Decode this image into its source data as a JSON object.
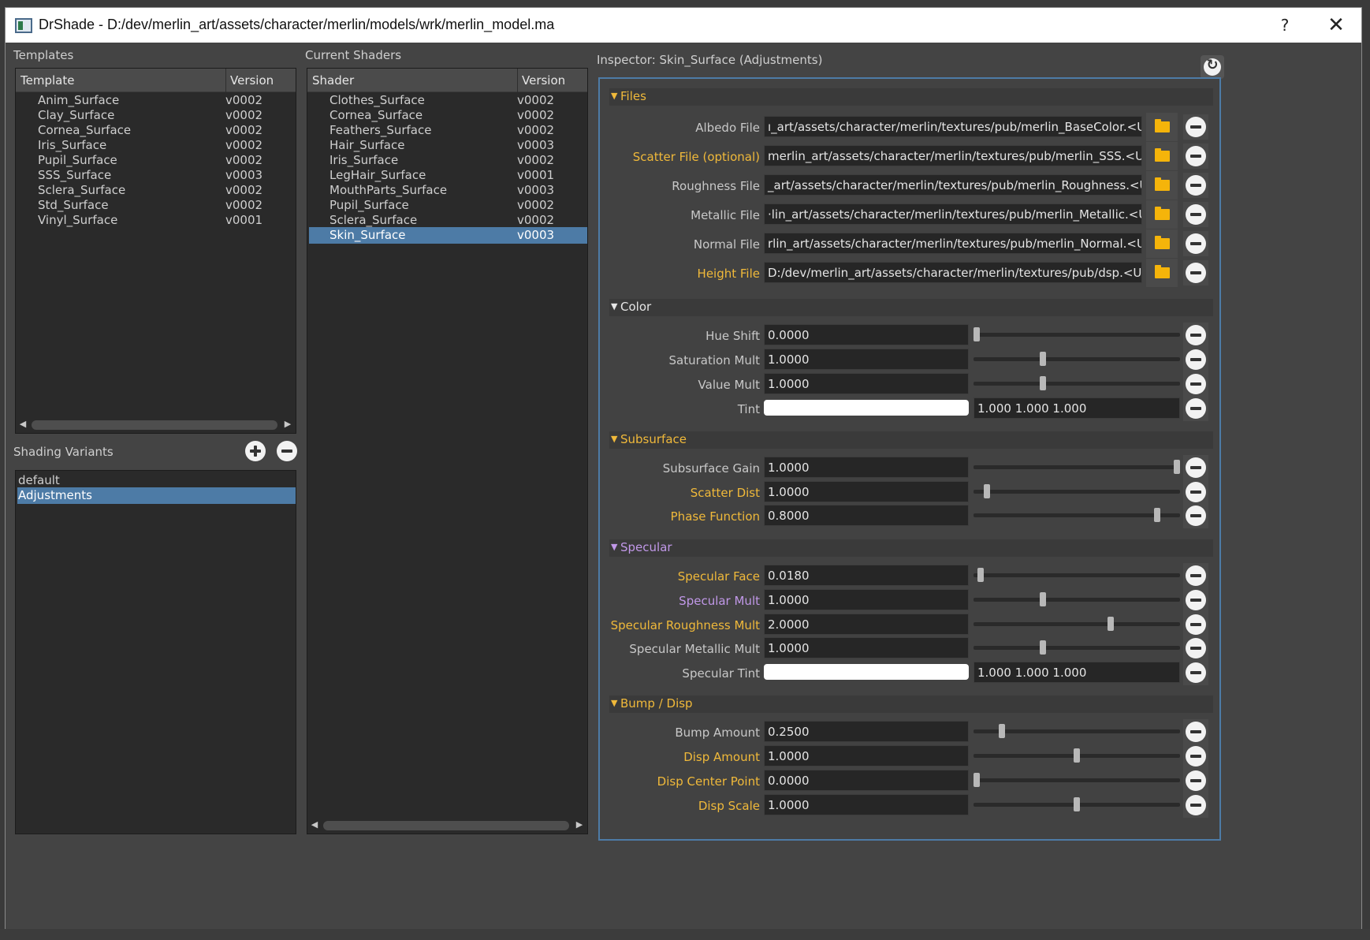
{
  "window": {
    "title": "DrShade - D:/dev/merlin_art/assets/character/merlin/models/wrk/merlin_model.ma",
    "help_label": "?",
    "close_label": "✕"
  },
  "templates": {
    "group_label": "Templates",
    "col_template": "Template",
    "col_version": "Version",
    "rows": [
      {
        "name": "Anim_Surface",
        "version": "v0002"
      },
      {
        "name": "Clay_Surface",
        "version": "v0002"
      },
      {
        "name": "Cornea_Surface",
        "version": "v0002"
      },
      {
        "name": "Iris_Surface",
        "version": "v0002"
      },
      {
        "name": "Pupil_Surface",
        "version": "v0002"
      },
      {
        "name": "SSS_Surface",
        "version": "v0003"
      },
      {
        "name": "Sclera_Surface",
        "version": "v0002"
      },
      {
        "name": "Std_Surface",
        "version": "v0002"
      },
      {
        "name": "Vinyl_Surface",
        "version": "v0001"
      }
    ]
  },
  "variants": {
    "group_label": "Shading Variants",
    "items": [
      "default",
      "Adjustments"
    ],
    "selected": "Adjustments"
  },
  "shaders": {
    "group_label": "Current Shaders",
    "col_shader": "Shader",
    "col_version": "Version",
    "rows": [
      {
        "name": "Clothes_Surface",
        "version": "v0002"
      },
      {
        "name": "Cornea_Surface",
        "version": "v0002"
      },
      {
        "name": "Feathers_Surface",
        "version": "v0002"
      },
      {
        "name": "Hair_Surface",
        "version": "v0003"
      },
      {
        "name": "Iris_Surface",
        "version": "v0002"
      },
      {
        "name": "LegHair_Surface",
        "version": "v0001"
      },
      {
        "name": "MouthParts_Surface",
        "version": "v0003"
      },
      {
        "name": "Pupil_Surface",
        "version": "v0002"
      },
      {
        "name": "Sclera_Surface",
        "version": "v0002"
      },
      {
        "name": "Skin_Surface",
        "version": "v0003"
      }
    ],
    "selected": "Skin_Surface"
  },
  "inspector": {
    "title": "Inspector: Skin_Surface (Adjustments)",
    "files": {
      "header": "Files",
      "albedo": {
        "label": "Albedo File",
        "value": "ı_art/assets/character/merlin/textures/pub/merlin_BaseColor.<UDIM>.png"
      },
      "scatter": {
        "label": "Scatter File (optional)",
        "value": "merlin_art/assets/character/merlin/textures/pub/merlin_SSS.<UDIM>.png"
      },
      "roughness": {
        "label": "Roughness File",
        "value": "_art/assets/character/merlin/textures/pub/merlin_Roughness.<UDIM>.png"
      },
      "metallic": {
        "label": "Metallic File",
        "value": "·lin_art/assets/character/merlin/textures/pub/merlin_Metallic.<UDIM>.png"
      },
      "normal": {
        "label": "Normal File",
        "value": "rlin_art/assets/character/merlin/textures/pub/merlin_Normal.<UDIM>.png"
      },
      "height": {
        "label": "Height File",
        "value": "D:/dev/merlin_art/assets/character/merlin/textures/pub/dsp.<UDIM>.exr"
      }
    },
    "color": {
      "header": "Color",
      "hue_shift": {
        "label": "Hue Shift",
        "value": "0.0000",
        "level": 0.0
      },
      "saturation_mult": {
        "label": "Saturation Mult",
        "value": "1.0000",
        "level": 0.33
      },
      "value_mult": {
        "label": "Value Mult",
        "value": "1.0000",
        "level": 0.33
      },
      "tint": {
        "label": "Tint",
        "value": "1.000 1.000 1.000",
        "color": "#ffffff"
      }
    },
    "subsurface": {
      "header": "Subsurface",
      "gain": {
        "label": "Subsurface Gain",
        "value": "1.0000",
        "level": 1.0
      },
      "scatter_dist": {
        "label": "Scatter Dist",
        "value": "1.0000",
        "level": 0.05
      },
      "phase_function": {
        "label": "Phase Function",
        "value": "0.8000",
        "level": 0.9
      }
    },
    "specular": {
      "header": "Specular",
      "face": {
        "label": "Specular Face",
        "value": "0.0180",
        "level": 0.02
      },
      "mult": {
        "label": "Specular Mult",
        "value": "1.0000",
        "level": 0.33
      },
      "roughness_mult": {
        "label": "Specular Roughness Mult",
        "value": "2.0000",
        "level": 0.67
      },
      "metallic_mult": {
        "label": "Specular Metallic Mult",
        "value": "1.0000",
        "level": 0.33
      },
      "tint": {
        "label": "Specular Tint",
        "value": "1.000 1.000 1.000",
        "color": "#ffffff"
      }
    },
    "bump": {
      "header": "Bump / Disp",
      "bump_amount": {
        "label": "Bump Amount",
        "value": "0.2500",
        "level": 0.125
      },
      "disp_amount": {
        "label": "Disp Amount",
        "value": "1.0000",
        "level": 0.5
      },
      "disp_center": {
        "label": "Disp Center Point",
        "value": "0.0000",
        "level": 0.0
      },
      "disp_scale": {
        "label": "Disp Scale",
        "value": "1.0000",
        "level": 0.5
      }
    }
  },
  "colors": {
    "selection": "#4d7ba6",
    "override_gold": "#f0b93a",
    "override_purple": "#c198e8",
    "folder_icon": "#f5b40a"
  }
}
